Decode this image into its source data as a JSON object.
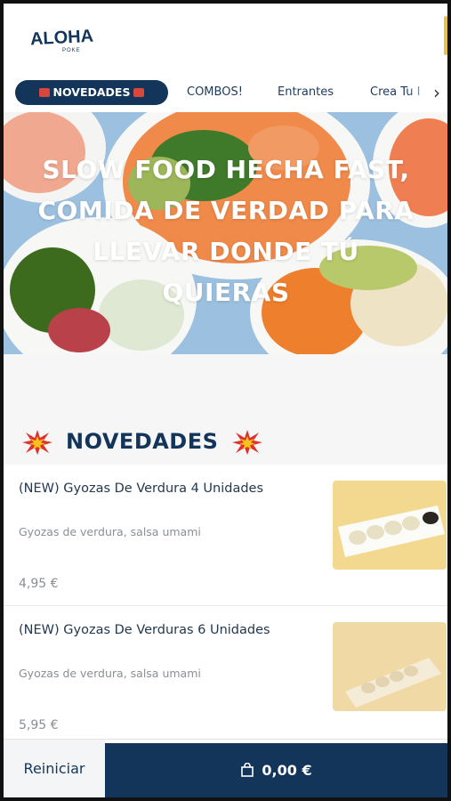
{
  "brand": {
    "logo_text": "ALOHA",
    "logo_sub": "POKE"
  },
  "tabs": [
    {
      "label": "NOVEDADES",
      "active": true,
      "icon": "explosion-icon"
    },
    {
      "label": "COMBOS!"
    },
    {
      "label": "Entrantes"
    },
    {
      "label": "Crea Tu I"
    }
  ],
  "hero": {
    "lines": [
      "SLOW FOOD HECHA FAST,",
      "COMIDA DE VERDAD PARA",
      "LLEVAR DONDE TÚ",
      "QUIERAS"
    ]
  },
  "section": {
    "title": "NOVEDADES",
    "icon": "explosion-icon"
  },
  "items": [
    {
      "name": "(NEW) Gyozas De Verdura 4 Unidades",
      "description": "Gyozas de verdura, salsa umami",
      "price": "4,95 €"
    },
    {
      "name": "(NEW) Gyozas De Verduras 6 Unidades",
      "description": "Gyozas de verdura, salsa umami",
      "price": "5,95 €"
    }
  ],
  "bottom": {
    "reset_label": "Reiniciar",
    "cart_total": "0,00 €",
    "cart_icon": "shopping-bag-icon"
  },
  "colors": {
    "navy": "#13355a",
    "accent_red": "#d9463b",
    "background": "#f6f6f7"
  }
}
